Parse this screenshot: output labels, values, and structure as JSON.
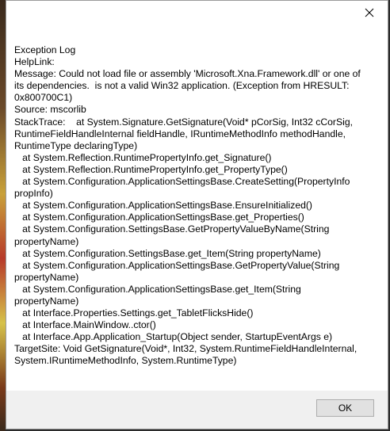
{
  "window": {
    "close_icon": "close-icon"
  },
  "message": {
    "text": "Exception Log\nHelpLink:\nMessage: Could not load file or assembly 'Microsoft.Xna.Framework.dll' or one of its dependencies.  is not a valid Win32 application. (Exception from HRESULT: 0x800700C1)\nSource: mscorlib\nStackTrace:    at System.Signature.GetSignature(Void* pCorSig, Int32 cCorSig, RuntimeFieldHandleInternal fieldHandle, IRuntimeMethodInfo methodHandle, RuntimeType declaringType)\n   at System.Reflection.RuntimePropertyInfo.get_Signature()\n   at System.Reflection.RuntimePropertyInfo.get_PropertyType()\n   at System.Configuration.ApplicationSettingsBase.CreateSetting(PropertyInfo propInfo)\n   at System.Configuration.ApplicationSettingsBase.EnsureInitialized()\n   at System.Configuration.ApplicationSettingsBase.get_Properties()\n   at System.Configuration.SettingsBase.GetPropertyValueByName(String propertyName)\n   at System.Configuration.SettingsBase.get_Item(String propertyName)\n   at System.Configuration.ApplicationSettingsBase.GetPropertyValue(String propertyName)\n   at System.Configuration.ApplicationSettingsBase.get_Item(String propertyName)\n   at Interface.Properties.Settings.get_TabletFlicksHide()\n   at Interface.MainWindow..ctor()\n   at Interface.App.Application_Startup(Object sender, StartupEventArgs e)\nTargetSite: Void GetSignature(Void*, Int32, System.RuntimeFieldHandleInternal, System.IRuntimeMethodInfo, System.RuntimeType)"
  },
  "buttons": {
    "ok_label": "OK"
  },
  "colors": {
    "dialog_bg": "#ffffff",
    "footer_bg": "#f0f0f0",
    "button_bg": "#e1e1e1",
    "button_border": "#adadad"
  }
}
